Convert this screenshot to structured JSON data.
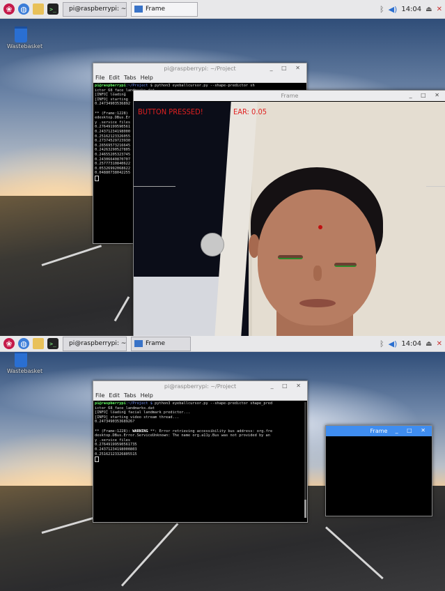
{
  "taskbar": {
    "terminal_task": "pi@raspberrypi: ~/Pr...",
    "frame_task": "Frame",
    "clock": "14:04"
  },
  "desktop": {
    "wastebasket_label": "Wastebasket"
  },
  "terminal": {
    "title": "pi@raspberrypi: ~/Project",
    "menu": [
      "File",
      "Edit",
      "Tabs",
      "Help"
    ],
    "prompt_user": "pi@raspberrypi",
    "prompt_path": ":~/Project $",
    "command": " python3 eyeballcursor.py --shape-predictor shape_pred",
    "command_cont": "ictor_68_face_landmarks.dat",
    "info_lines": [
      "[INFO] loading facial landmark predictor...",
      "[INFO] starting video stream thread..."
    ],
    "first_value": "0.247349035368926?",
    "warning_prefix": "** (Frame:1228): ",
    "warning_word": "WARNING",
    "warning_rest": " **: Error retrieving accessibility bus address: org.fre",
    "warning_line2": "desktop.DBus.Error.ServiceUnknown: The name org.a11y.Bus was not provided by an",
    "warning_line3": "y .service files",
    "values_bottom": [
      "0.27649199590561735",
      "0.24371234198000803",
      "0.25162123326805515"
    ],
    "top_visible": {
      "command": "$ python3 eyeballcursor.py --shape-predictor sh",
      "command_cont": "ictor_68_face_landmarks.dat",
      "info1": "[INFO] loading",
      "info2": "[INFO] starting",
      "first_value": "0.24734903536892",
      "warn1": "** (Frame:1228)",
      "warn2": "edesktop.DBus.Er",
      "warn3": "y .service files",
      "values": [
        "0.27649199590561",
        "0.24371234198000",
        "0.25162123326055",
        "0.27374529723930",
        "0.26569573216645",
        "0.24263290527805",
        "0.24655205323745",
        "0.24306640870707",
        "0.25777310840622",
        "0.05326992068622",
        "0.04880738042255"
      ]
    }
  },
  "frame_window": {
    "title": "Frame",
    "overlay_button": "BUTTON PRESSED!",
    "overlay_ear": "EAR: 0.05"
  },
  "colors": {
    "overlay_red": "#e02020",
    "eye_contour": "#2b8a2b",
    "frame_title_active": "#3f8df0"
  }
}
